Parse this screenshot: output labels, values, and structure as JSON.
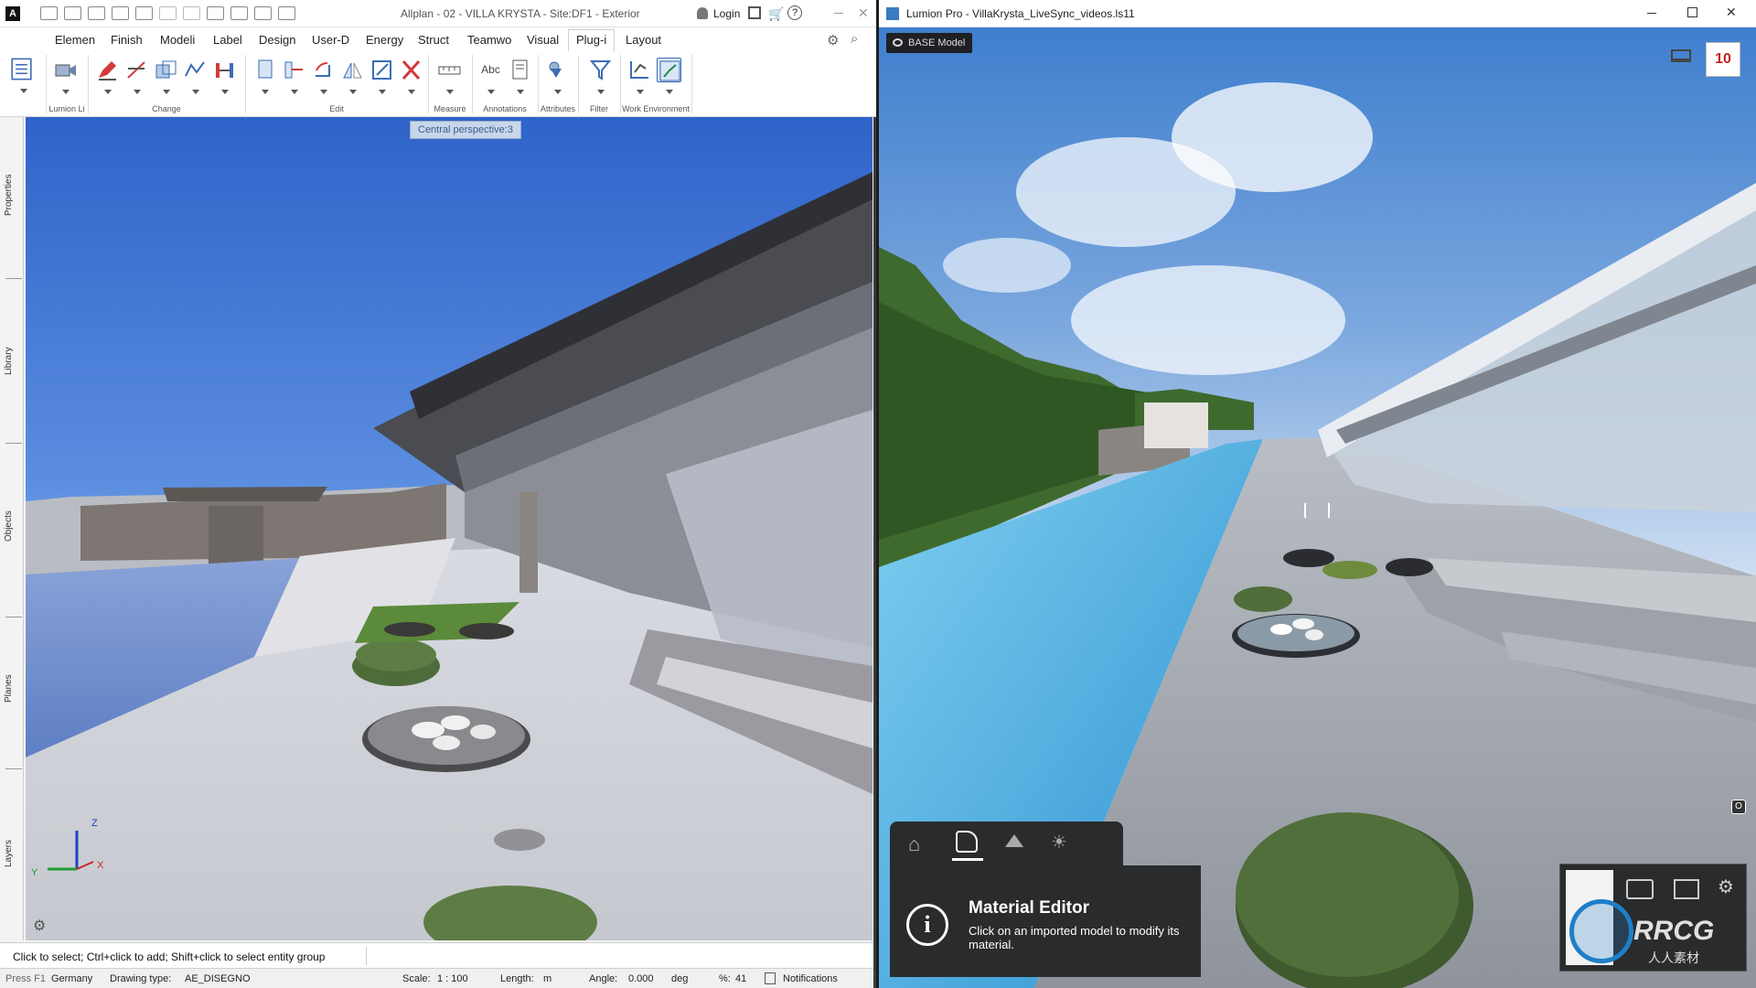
{
  "allplan": {
    "title": "Allplan - 02 - VILLA KRYSTA - Site:DF1 - Exterior",
    "login_label": "Login",
    "menu_tabs": [
      "Elemen",
      "Finish",
      "Modeli",
      "Label",
      "Design",
      "User-D",
      "Energy",
      "Struct",
      "Teamwo",
      "Visual",
      "Plug-i",
      "Layout"
    ],
    "active_tab": "Plug-i",
    "ribbon_groups": [
      "Lumion Li",
      "Change",
      "Edit",
      "Measure",
      "Annotations",
      "Attributes",
      "Filter",
      "Work Environment"
    ],
    "annotation_abc": "Abc",
    "sidebar_tabs": [
      "Properties",
      "Library",
      "Objects",
      "Planes",
      "Layers"
    ],
    "viewport_label": "Central perspective:3",
    "axis_labels": {
      "z": "Z",
      "x": "X",
      "y": "Y"
    },
    "command_line": "Click to select; Ctrl+click to add; Shift+click to select entity group",
    "status": {
      "help": "Press F1",
      "country": "Germany",
      "drawing_type_label": "Drawing type:",
      "drawing_type": "AE_DISEGNO",
      "scale_label": "Scale:",
      "scale": "1 : 100",
      "length_label": "Length:",
      "length_unit": "m",
      "angle_label": "Angle:",
      "angle": "0.000",
      "angle_unit": "deg",
      "percent_label": "%:",
      "percent": "41",
      "notifications": "Notifications"
    }
  },
  "lumion": {
    "title": "Lumion Pro - VillaKrysta_LiveSync_videos.ls11",
    "base_model": "BASE Model",
    "counter": "10",
    "panel": {
      "tabs": [
        "home-icon",
        "material-icon",
        "landscape-icon",
        "weather-icon"
      ],
      "active_tab": "material-icon",
      "heading": "Material Editor",
      "body": "Click on an imported model to modify its material."
    },
    "watermark": "RRCG",
    "watermark_cn": "人人素材"
  }
}
